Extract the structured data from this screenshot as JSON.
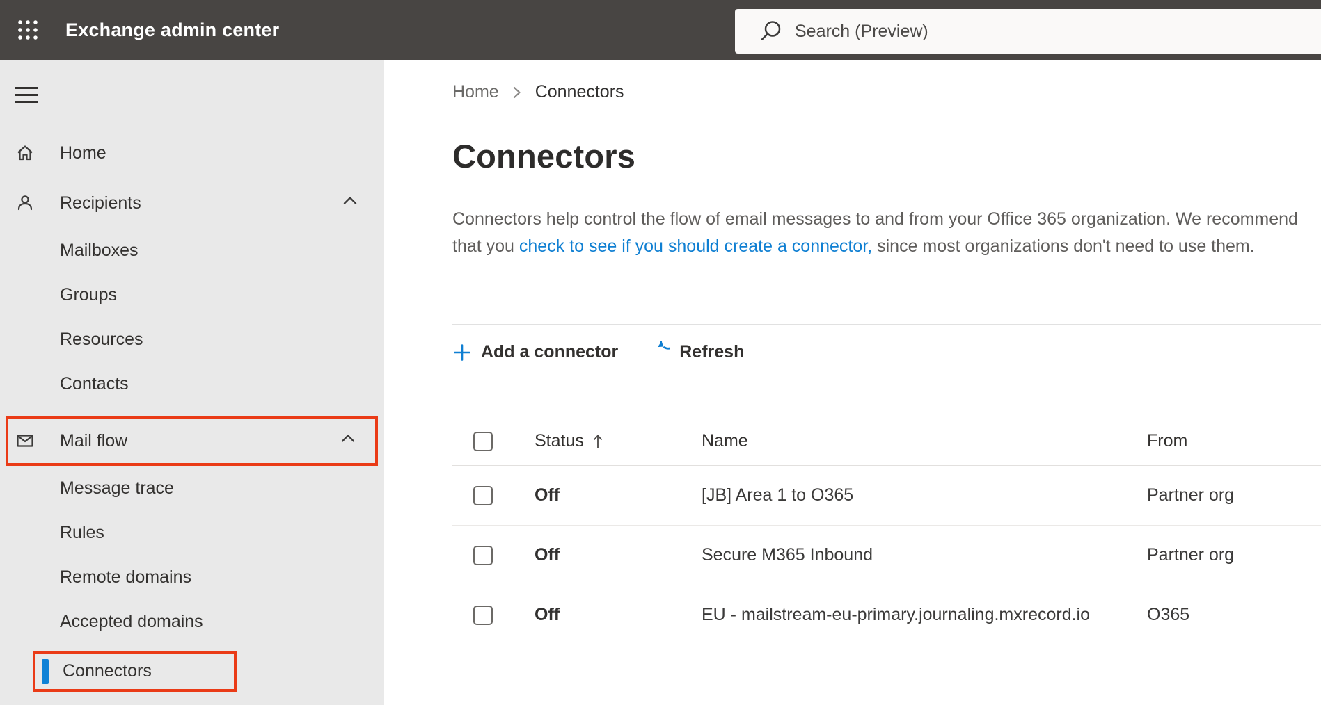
{
  "topbar": {
    "app_title": "Exchange admin center",
    "search_placeholder": "Search (Preview)"
  },
  "sidebar": {
    "items": [
      {
        "label": "Home",
        "icon": "home"
      },
      {
        "label": "Recipients",
        "icon": "person",
        "expanded": true
      },
      {
        "label": "Mailboxes"
      },
      {
        "label": "Groups"
      },
      {
        "label": "Resources"
      },
      {
        "label": "Contacts"
      },
      {
        "label": "Mail flow",
        "icon": "envelope",
        "expanded": true,
        "annotated": true
      },
      {
        "label": "Message trace"
      },
      {
        "label": "Rules"
      },
      {
        "label": "Remote domains"
      },
      {
        "label": "Accepted domains"
      },
      {
        "label": "Connectors",
        "selected": true,
        "annotated": true
      }
    ]
  },
  "breadcrumb": {
    "home": "Home",
    "current": "Connectors"
  },
  "page": {
    "title": "Connectors",
    "description_before": "Connectors help control the flow of email messages to and from your Office 365 organization. We recommend that you ",
    "description_link": "check to see if you should create a connector,",
    "description_after": " since most organizations don't need to use them."
  },
  "toolbar": {
    "add_label": "Add a connector",
    "refresh_label": "Refresh"
  },
  "table": {
    "headers": {
      "status": "Status",
      "name": "Name",
      "from": "From"
    },
    "sort_column": "Status",
    "sort_direction": "ascending",
    "rows": [
      {
        "status": "Off",
        "name": "[JB] Area 1 to O365",
        "from": "Partner org"
      },
      {
        "status": "Off",
        "name": "Secure M365 Inbound",
        "from": "Partner org"
      },
      {
        "status": "Off",
        "name": "EU - mailstream-eu-primary.journaling.mxrecord.io",
        "from": "O365"
      }
    ]
  },
  "icons": {
    "app_launcher": "waffle-grid",
    "search": "magnifier",
    "nav_toggle": "hamburger",
    "home": "house-outline",
    "recipients": "person-outline",
    "mail_flow": "envelope-outline",
    "expand": "chevron-up",
    "breadcrumb_separator": "chevron-right",
    "add": "plus",
    "refresh": "circular-arrow",
    "sort": "arrow-up",
    "row_select": "empty-checkbox"
  },
  "colors": {
    "topbar_bg": "#484543",
    "sidebar_bg": "#e9e9e9",
    "accent_blue": "#0f7fd2",
    "annotation_red": "#ea3b17",
    "text_dark": "#323130",
    "text_gray": "#5f5d5b"
  }
}
